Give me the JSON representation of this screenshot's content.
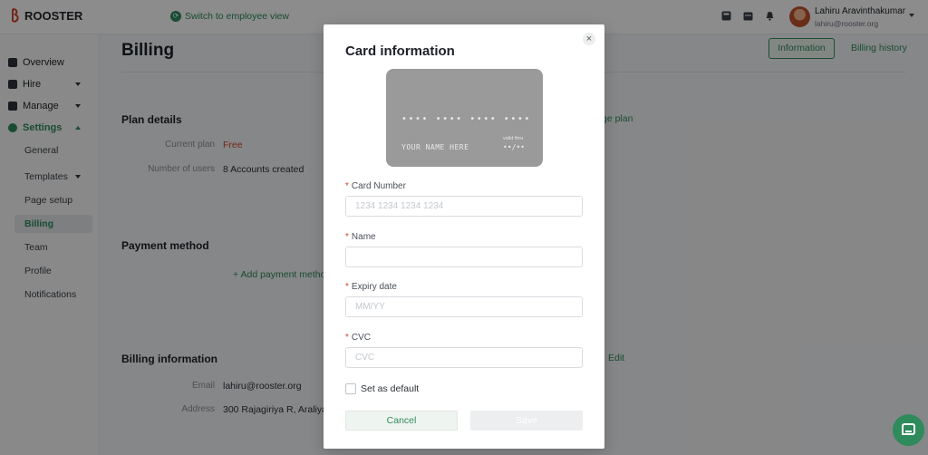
{
  "app": {
    "logo_text": "ROOSTER"
  },
  "topbar": {
    "switch_label": "Switch to employee view",
    "user_name": "Lahiru Aravinthakumar",
    "user_email": "lahiru@rooster.org",
    "icons": [
      "calculator-icon",
      "calendar-icon",
      "bell-icon"
    ]
  },
  "sidebar": {
    "items": [
      {
        "label": "Overview",
        "icon": "overview-icon"
      },
      {
        "label": "Hire",
        "icon": "briefcase-icon"
      },
      {
        "label": "Manage",
        "icon": "people-icon"
      },
      {
        "label": "Settings",
        "icon": "gear-icon"
      }
    ],
    "settings_sub": [
      "General",
      "Templates",
      "Page setup",
      "Billing",
      "Team",
      "Profile",
      "Notifications"
    ]
  },
  "page": {
    "title": "Billing",
    "tab_information": "Information",
    "tab_billing_history": "Billing history",
    "plan": {
      "heading": "Plan details",
      "current_plan_label": "Current plan",
      "current_plan_value": "Free",
      "users_label": "Number of users",
      "users_value": "8 Accounts created",
      "change_link": "ge plan"
    },
    "payment": {
      "heading": "Payment method",
      "add_link": "+ Add payment metho"
    },
    "billing_info": {
      "heading": "Billing information",
      "edit_link": "Edit",
      "email_label": "Email",
      "email_value": "lahiru@rooster.org",
      "address_label": "Address",
      "address_value": "300 Rajagiriya R, Araliya U"
    }
  },
  "modal": {
    "title": "Card information",
    "close_glyph": "×",
    "card_preview": {
      "number": "•••• •••• •••• ••••",
      "name": "YOUR NAME HERE",
      "valid_thru": "valid thru",
      "expiry": "••/••"
    },
    "fields": {
      "card_number": {
        "label": "Card Number",
        "placeholder": "1234 1234 1234 1234",
        "value": ""
      },
      "name": {
        "label": "Name",
        "placeholder": "",
        "value": ""
      },
      "expiry": {
        "label": "Expiry date",
        "placeholder": "MM/YY",
        "value": ""
      },
      "cvc": {
        "label": "CVC",
        "placeholder": "CVC",
        "value": ""
      }
    },
    "required_mark": "*",
    "default_checkbox_label": "Set as default",
    "default_checked": false,
    "cancel_label": "Cancel",
    "save_label": "Save"
  },
  "colors": {
    "brand": "#2f8a5c",
    "danger": "#d0452b"
  }
}
